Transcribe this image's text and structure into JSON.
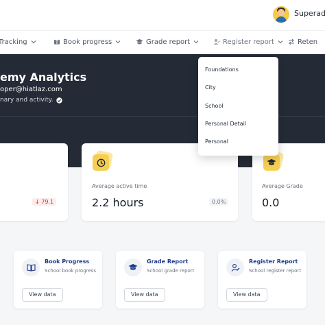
{
  "header": {
    "user_name": "Superadm"
  },
  "nav": {
    "items": [
      {
        "label": "Tracking"
      },
      {
        "label": "Book progress"
      },
      {
        "label": "Grade report"
      },
      {
        "label": "Register report"
      },
      {
        "label": "Reten"
      }
    ]
  },
  "hero": {
    "title": "emy Analytics",
    "email": "oper@hiatlaz.com",
    "subtitle": "nary and activity."
  },
  "stats": [
    {
      "label": "",
      "value": "",
      "badge": "↓ 79.1",
      "badge_color": "#dc2626"
    },
    {
      "label": "Average active time",
      "value": "2.2 hours",
      "badge": "0.0%",
      "icon": "clock-icon"
    },
    {
      "label": "Average Grade",
      "value": "0.0",
      "icon": "graduation-cap-icon"
    }
  ],
  "reports": [
    {
      "title": "Book Progress",
      "subtitle": "School book progress",
      "button": "View data",
      "icon": "book-icon"
    },
    {
      "title": "Grade Report",
      "subtitle": "School grade report",
      "button": "View data",
      "icon": "graduation-cap-icon"
    },
    {
      "title": "Register Report",
      "subtitle": "School register report",
      "button": "View data",
      "icon": "user-edit-icon"
    }
  ],
  "dropdown": {
    "items": [
      {
        "label": "Foundations"
      },
      {
        "label": "City"
      },
      {
        "label": "School"
      },
      {
        "label": "Personal Detail"
      },
      {
        "label": "Personal"
      }
    ]
  },
  "colors": {
    "hero_bg": "#252b36",
    "accent_yellow": "#f6cf52",
    "title_blue": "#1e3a8a",
    "negative_red": "#dc2626"
  }
}
